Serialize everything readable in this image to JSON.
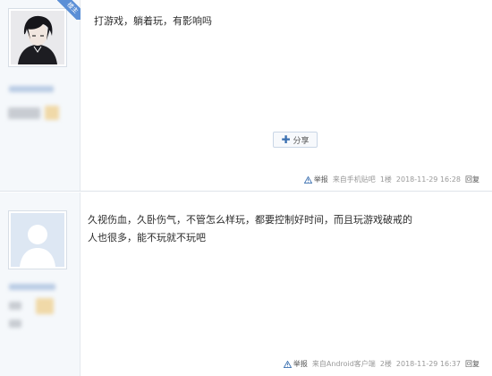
{
  "posts": [
    {
      "badge": "楼主",
      "text": "打游戏，躺着玩，有影响吗",
      "share_label": "分享",
      "report_label": "举报",
      "source": "来自手机贴吧",
      "floor": "1楼",
      "timestamp": "2018-11-29 16:28",
      "reply_label": "回复"
    },
    {
      "text": "久视伤血，久卧伤气，不管怎么样玩，都要控制好时间，而且玩游戏破戒的人也很多，能不玩就不玩吧",
      "report_label": "举报",
      "source": "来自Android客户端",
      "floor": "2楼",
      "timestamp": "2018-11-29 16:37",
      "reply_label": "回复"
    }
  ],
  "colors": {
    "badge": "#5b8fd6",
    "sidebar_bg": "#f5f8fb",
    "link": "#3a6fb0"
  }
}
